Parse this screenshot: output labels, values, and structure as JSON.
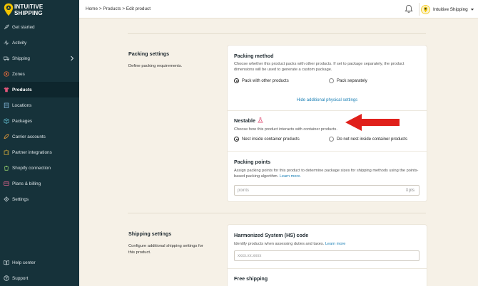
{
  "brand": {
    "name_line1": "INTUITIVE",
    "name_line2": "SHIPPING",
    "pin_color": "#f2c300"
  },
  "sidebar": {
    "items": [
      {
        "label": "Get started",
        "icon": "rocket-icon"
      },
      {
        "label": "Activity",
        "icon": "pulse-icon"
      },
      {
        "label": "Shipping",
        "icon": "truck-icon",
        "has_children": true
      },
      {
        "label": "Zones",
        "icon": "map-pin-icon"
      },
      {
        "label": "Products",
        "icon": "shirt-icon",
        "active": true
      },
      {
        "label": "Locations",
        "icon": "building-icon"
      },
      {
        "label": "Packages",
        "icon": "box-icon"
      },
      {
        "label": "Carrier accounts",
        "icon": "carrier-icon"
      },
      {
        "label": "Partner integrations",
        "icon": "puzzle-icon"
      },
      {
        "label": "Shopify connection",
        "icon": "shopify-icon"
      },
      {
        "label": "Plans & billing",
        "icon": "card-icon"
      },
      {
        "label": "Settings",
        "icon": "gear-icon"
      }
    ],
    "bottom": [
      {
        "label": "Help center",
        "icon": "book-icon"
      },
      {
        "label": "Support",
        "icon": "help-icon"
      }
    ]
  },
  "topbar": {
    "breadcrumb": [
      "Home",
      "Products",
      "Edit product"
    ],
    "separator": " > ",
    "account_name": "Intuitive Shipping"
  },
  "packing_settings": {
    "title": "Packing settings",
    "description": "Define packing requirements.",
    "packing_method": {
      "title": "Packing method",
      "description": "Choose whether this product packs with other products. If set to package separately, the product dimensions will be used to generate a custom package.",
      "options": [
        "Pack with other products",
        "Pack separately"
      ],
      "selected": "Pack with other products",
      "toggle_link": "Hide additional physical settings"
    },
    "nestable": {
      "title": "Nestable",
      "description": "Choose how this product interacts with container products.",
      "options": [
        "Nest inside container products",
        "Do not nest inside container products"
      ],
      "selected": "Nest inside container products"
    },
    "packing_points": {
      "title": "Packing points",
      "description": "Assign packing points for this product to determine package sizes for shipping methods using the points-based packing algorithm.",
      "learn_more": "Learn more.",
      "placeholder": "points",
      "suffix": "pts"
    }
  },
  "shipping_settings": {
    "title": "Shipping settings",
    "description": "Configure additional shipping settings for this product.",
    "hs_code": {
      "title": "Harmonized System (HS) code",
      "description": "Identify products when assessing duties and taxes.",
      "learn_more": "Learn more",
      "placeholder": "xxxx.xx.xxxx"
    },
    "free_shipping": {
      "title": "Free shipping"
    }
  },
  "colors": {
    "sidebar_bg": "#16323a",
    "page_bg": "#f6f1e7",
    "link": "#1a7fb5",
    "arrow": "#e0201b",
    "flask": "#e0567a"
  }
}
